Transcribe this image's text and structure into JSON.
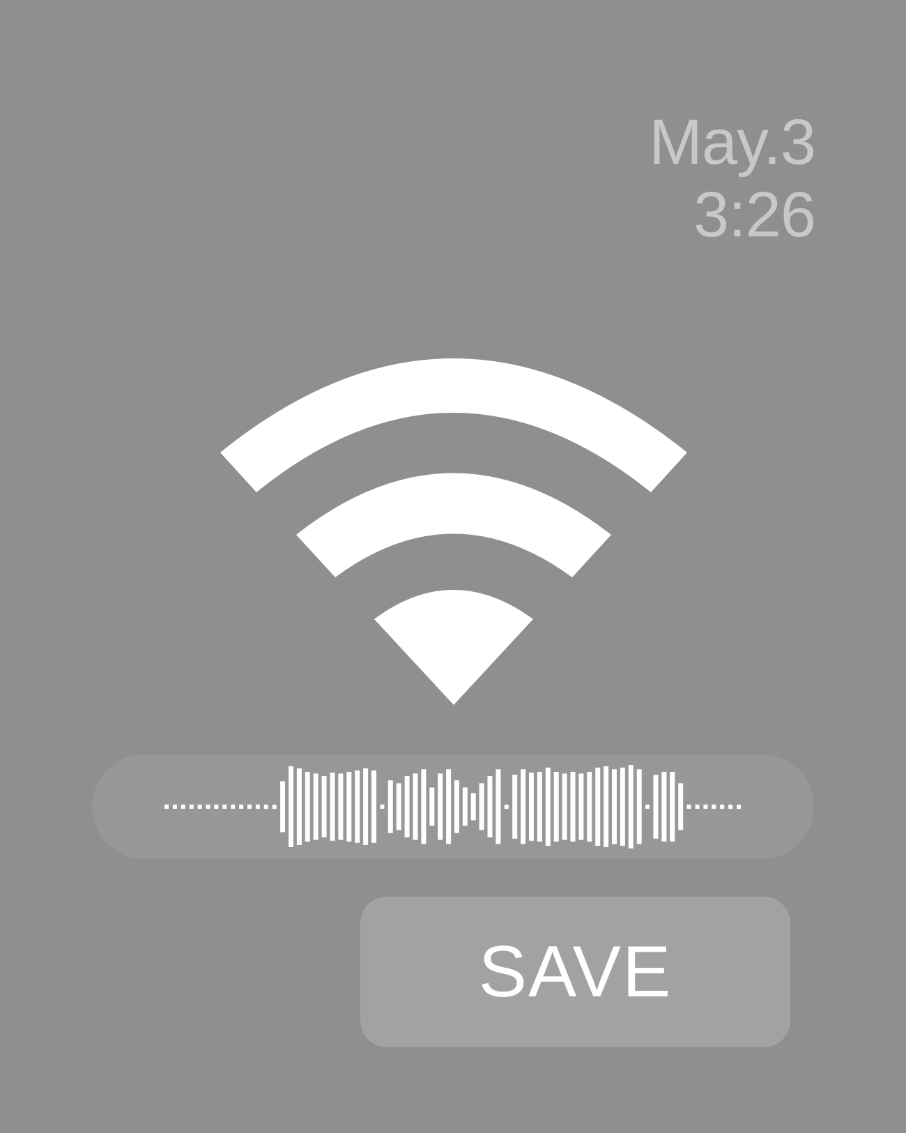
{
  "status": {
    "date": "May.3",
    "time": "3:26"
  },
  "recording": {
    "level_icon": "wifi-signal-icon",
    "waveform": [
      0.04,
      0.04,
      0.04,
      0.04,
      0.04,
      0.04,
      0.04,
      0.04,
      0.04,
      0.04,
      0.04,
      0.04,
      0.04,
      0.04,
      0.6,
      0.95,
      0.9,
      0.82,
      0.78,
      0.72,
      0.8,
      0.78,
      0.82,
      0.85,
      0.9,
      0.85,
      0.04,
      0.62,
      0.55,
      0.72,
      0.78,
      0.88,
      0.45,
      0.78,
      0.88,
      0.62,
      0.45,
      0.32,
      0.55,
      0.72,
      0.88,
      0.04,
      0.75,
      0.88,
      0.8,
      0.82,
      0.92,
      0.82,
      0.78,
      0.82,
      0.78,
      0.82,
      0.92,
      0.95,
      0.88,
      0.92,
      0.98,
      0.88,
      0.04,
      0.75,
      0.82,
      0.82,
      0.55,
      0.04,
      0.04,
      0.04,
      0.04,
      0.04,
      0.04,
      0.04
    ]
  },
  "actions": {
    "save_label": "SAVE"
  },
  "colors": {
    "background": "#8f8f8f",
    "datetime_text": "#c8c8c8",
    "waveform_pill": "#979797",
    "save_button": "#a2a2a2",
    "foreground": "#ffffff"
  }
}
